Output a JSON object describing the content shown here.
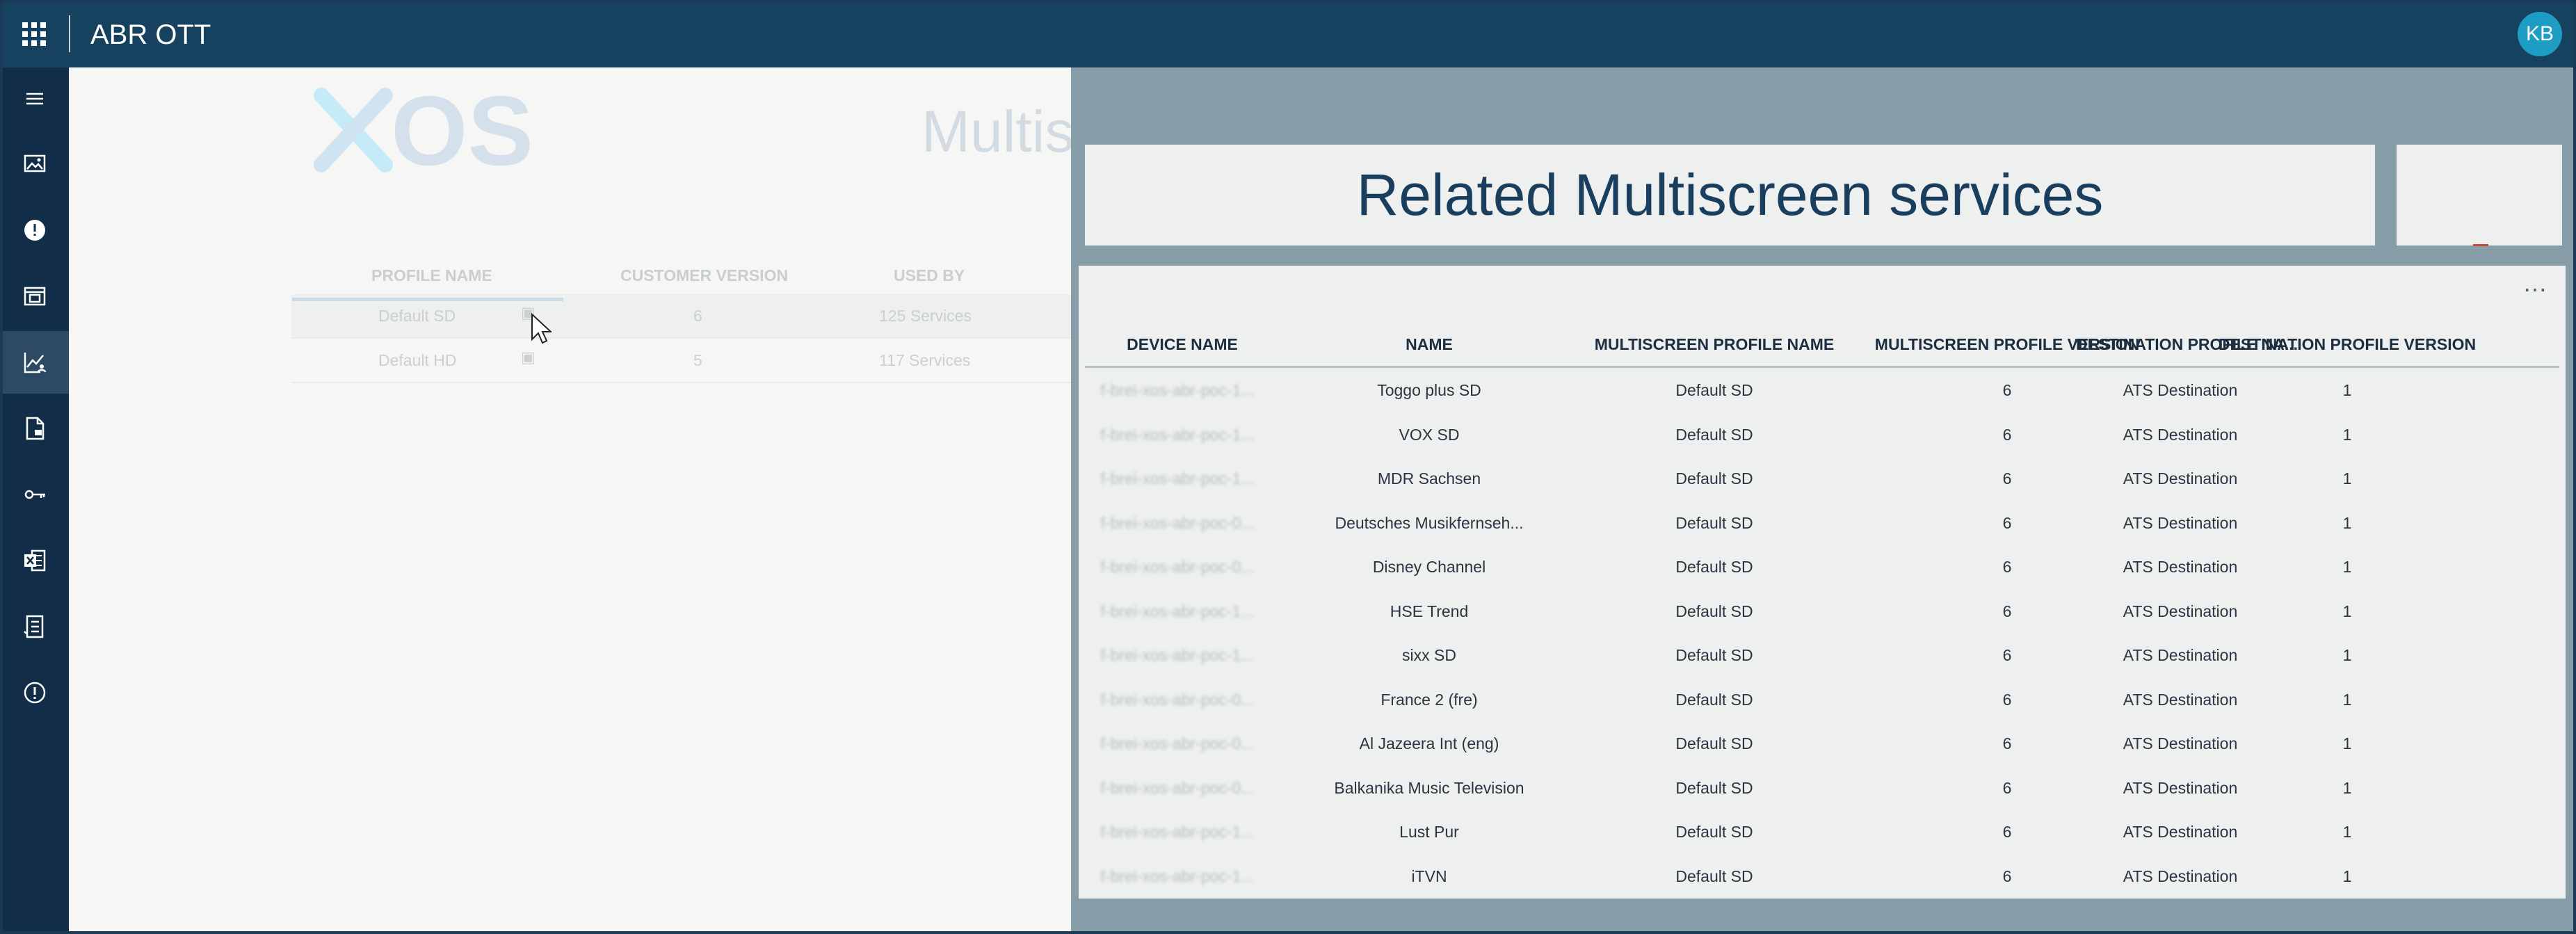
{
  "topbar": {
    "title": "ABR OTT",
    "user_initials": "KB"
  },
  "sidebar": {
    "items": [
      {
        "name": "menu-icon"
      },
      {
        "name": "image-gallery-icon"
      },
      {
        "name": "alert-icon"
      },
      {
        "name": "media-panel-icon"
      },
      {
        "name": "analytics-user-icon",
        "active": true
      },
      {
        "name": "document-export-icon"
      },
      {
        "name": "key-icon"
      },
      {
        "name": "excel-icon"
      },
      {
        "name": "checklist-icon"
      },
      {
        "name": "info-icon"
      }
    ]
  },
  "background": {
    "logo_text": "XOS",
    "heading": "Multis",
    "table": {
      "columns": [
        "PROFILE NAME",
        "CUSTOMER VERSION",
        "USED BY"
      ],
      "rows": [
        {
          "profile": "Default SD",
          "version": "6",
          "used_by": "125 Services"
        },
        {
          "profile": "Default HD",
          "version": "5",
          "used_by": "117 Services"
        }
      ]
    }
  },
  "panel": {
    "title": "Related Multiscreen services",
    "more_label": "⋯",
    "columns": [
      "DEVICE NAME",
      "NAME",
      "MULTISCREEN PROFILE NAME",
      "MULTISCREEN PROFILE VERSION",
      "DESTINATION PROFILE NA...",
      "DESTINATION PROFILE VERSION"
    ],
    "rows": [
      {
        "device": "f-brei-xos-abr-poc-1...",
        "name": "Toggo plus SD",
        "profile": "Default SD",
        "profile_version": "6",
        "destination": "ATS Destination",
        "destination_version": "1"
      },
      {
        "device": "f-brei-xos-abr-poc-1...",
        "name": "VOX SD",
        "profile": "Default SD",
        "profile_version": "6",
        "destination": "ATS Destination",
        "destination_version": "1"
      },
      {
        "device": "f-brei-xos-abr-poc-1...",
        "name": "MDR Sachsen",
        "profile": "Default SD",
        "profile_version": "6",
        "destination": "ATS Destination",
        "destination_version": "1"
      },
      {
        "device": "f-brei-xos-abr-poc-0...",
        "name": "Deutsches Musikfernseh...",
        "profile": "Default SD",
        "profile_version": "6",
        "destination": "ATS Destination",
        "destination_version": "1"
      },
      {
        "device": "f-brei-xos-abr-poc-0...",
        "name": "Disney Channel",
        "profile": "Default SD",
        "profile_version": "6",
        "destination": "ATS Destination",
        "destination_version": "1"
      },
      {
        "device": "f-brei-xos-abr-poc-1...",
        "name": "HSE Trend",
        "profile": "Default SD",
        "profile_version": "6",
        "destination": "ATS Destination",
        "destination_version": "1"
      },
      {
        "device": "f-brei-xos-abr-poc-1...",
        "name": "sixx SD",
        "profile": "Default SD",
        "profile_version": "6",
        "destination": "ATS Destination",
        "destination_version": "1"
      },
      {
        "device": "f-brei-xos-abr-poc-0...",
        "name": "France 2 (fre)",
        "profile": "Default SD",
        "profile_version": "6",
        "destination": "ATS Destination",
        "destination_version": "1"
      },
      {
        "device": "f-brei-xos-abr-poc-0...",
        "name": "Al Jazeera Int (eng)",
        "profile": "Default SD",
        "profile_version": "6",
        "destination": "ATS Destination",
        "destination_version": "1"
      },
      {
        "device": "f-brei-xos-abr-poc-0...",
        "name": "Balkanika Music Television",
        "profile": "Default SD",
        "profile_version": "6",
        "destination": "ATS Destination",
        "destination_version": "1"
      },
      {
        "device": "f-brei-xos-abr-poc-1...",
        "name": "Lust Pur",
        "profile": "Default SD",
        "profile_version": "6",
        "destination": "ATS Destination",
        "destination_version": "1"
      },
      {
        "device": "f-brei-xos-abr-poc-1...",
        "name": "iTVN",
        "profile": "Default SD",
        "profile_version": "6",
        "destination": "ATS Destination",
        "destination_version": "1"
      }
    ]
  }
}
